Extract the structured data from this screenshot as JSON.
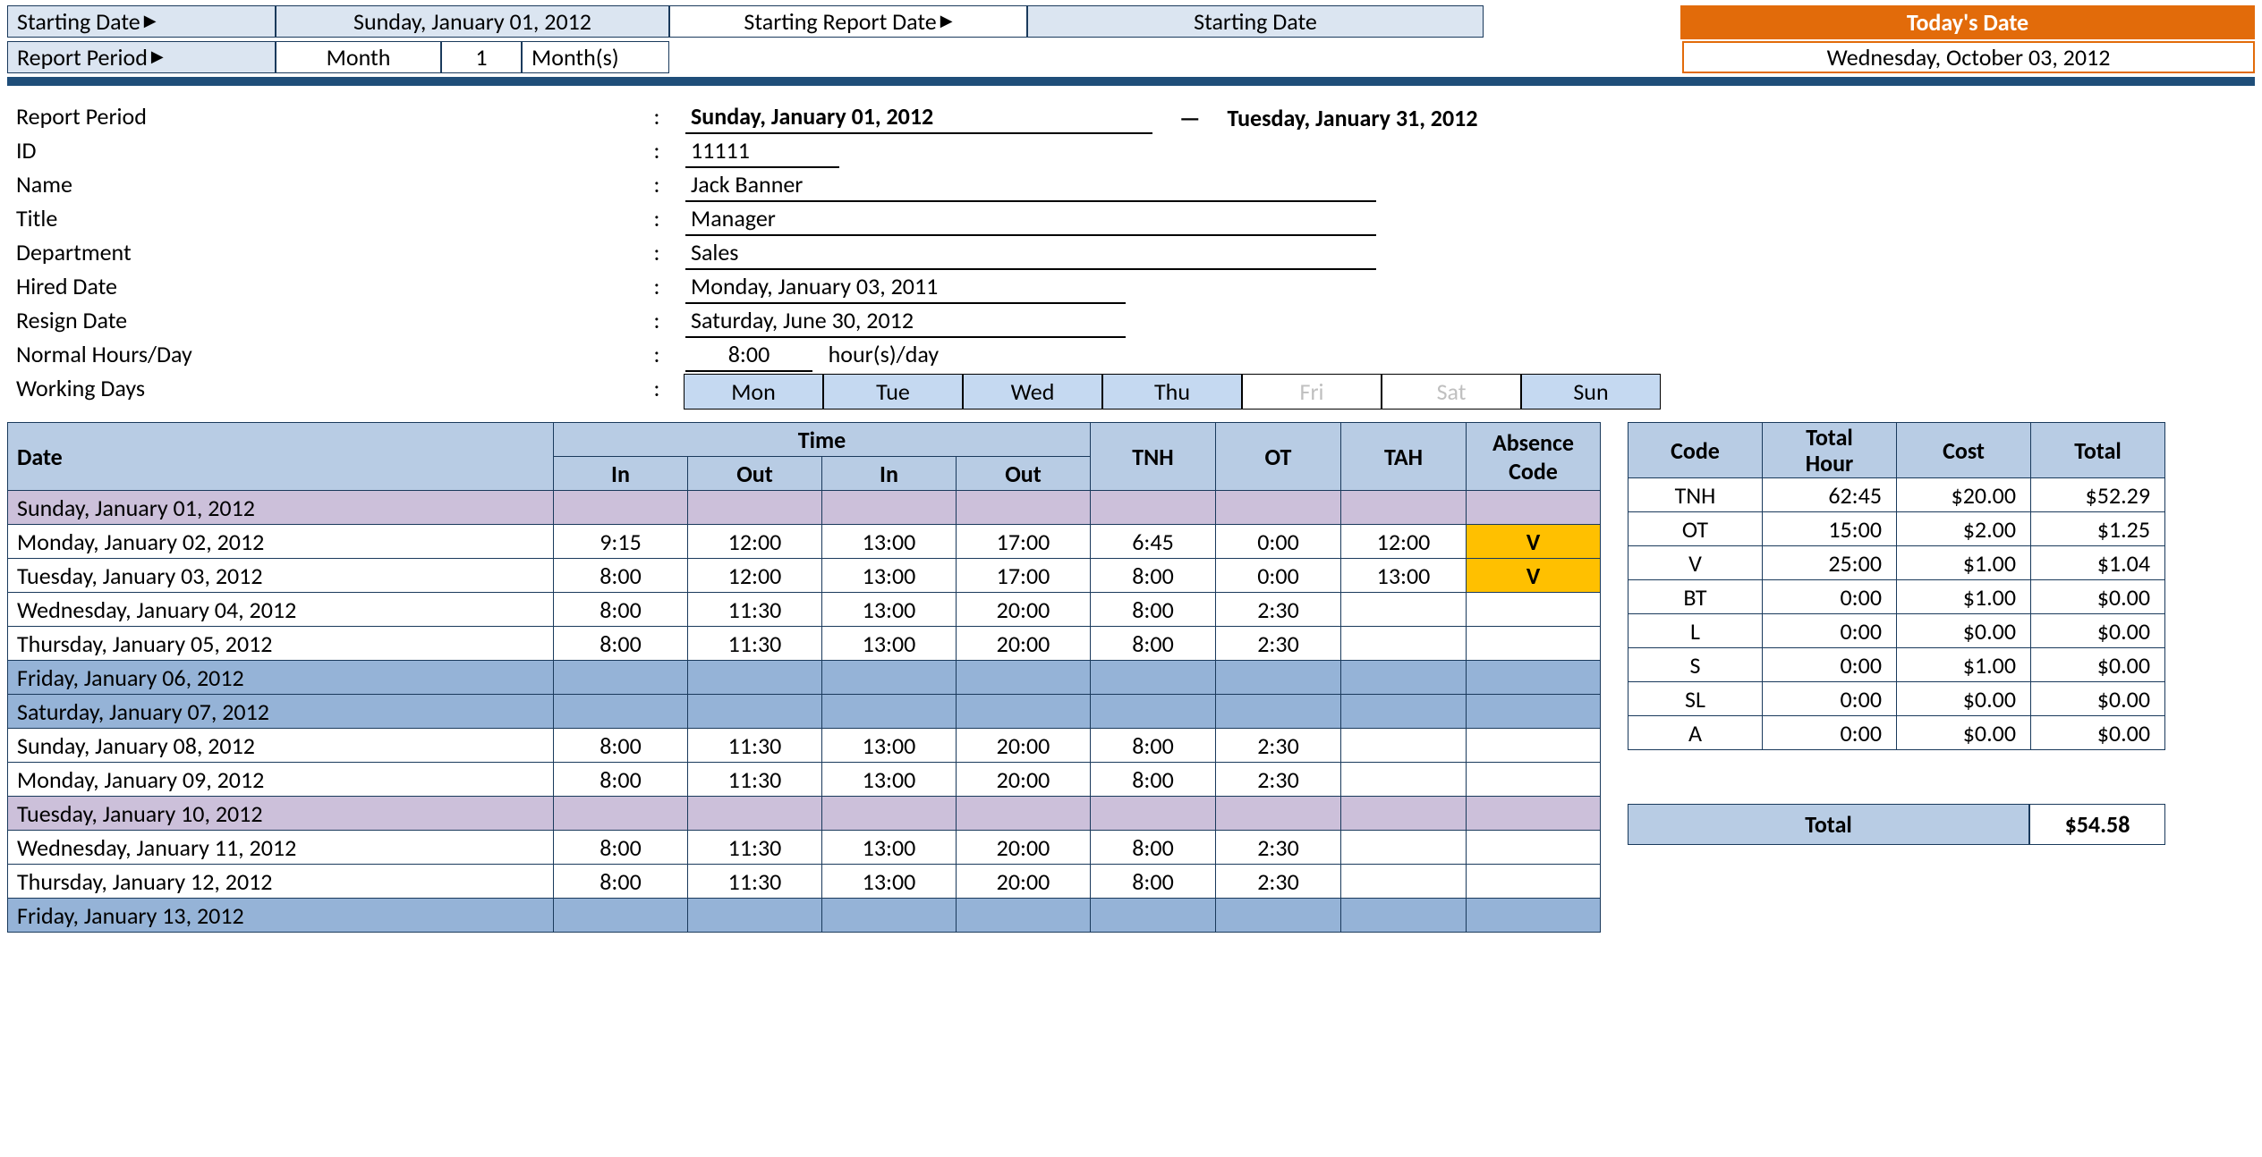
{
  "header": {
    "starting_date_label": "Starting Date",
    "starting_date_value": "Sunday, January 01, 2012",
    "starting_report_label": "Starting Report Date",
    "starting_report_sel": "Starting Date",
    "report_period_label": "Report Period",
    "rp_unit": "Month",
    "rp_qty": "1",
    "rp_suffix": "Month(s)",
    "today_label": "Today's Date",
    "today_value": "Wednesday, October 03, 2012"
  },
  "info": {
    "rp_label": "Report Period",
    "rp_start": "Sunday, January 01, 2012",
    "rp_end": "Tuesday, January 31, 2012",
    "id_label": "ID",
    "id": "11111",
    "name_label": "Name",
    "name": "Jack Banner",
    "title_label": "Title",
    "title": "Manager",
    "dept_label": "Department",
    "dept": "Sales",
    "hired_label": "Hired Date",
    "hired": "Monday, January 03, 2011",
    "resign_label": "Resign Date",
    "resign": "Saturday, June 30, 2012",
    "nhd_label": "Normal Hours/Day",
    "nhd_val": "8:00",
    "nhd_suffix": "hour(s)/day",
    "wd_label": "Working Days"
  },
  "wdays": [
    {
      "d": "Mon",
      "off": false
    },
    {
      "d": "Tue",
      "off": false
    },
    {
      "d": "Wed",
      "off": false
    },
    {
      "d": "Thu",
      "off": false
    },
    {
      "d": "Fri",
      "off": true
    },
    {
      "d": "Sat",
      "off": true
    },
    {
      "d": "Sun",
      "off": false
    }
  ],
  "cols": {
    "date": "Date",
    "time": "Time",
    "in": "In",
    "out": "Out",
    "tnh": "TNH",
    "ot": "OT",
    "tah": "TAH",
    "abs": "Absence Code"
  },
  "rows": [
    {
      "date": "Sunday, January 01, 2012",
      "class": "purple"
    },
    {
      "date": "Monday, January 02, 2012",
      "in1": "9:15",
      "out1": "12:00",
      "in2": "13:00",
      "out2": "17:00",
      "tnh": "6:45",
      "ot": "0:00",
      "tah": "12:00",
      "abs": "V",
      "gold": true
    },
    {
      "date": "Tuesday, January 03, 2012",
      "in1": "8:00",
      "out1": "12:00",
      "in2": "13:00",
      "out2": "17:00",
      "tnh": "8:00",
      "ot": "0:00",
      "tah": "13:00",
      "abs": "V",
      "gold": true
    },
    {
      "date": "Wednesday, January 04, 2012",
      "in1": "8:00",
      "out1": "11:30",
      "in2": "13:00",
      "out2": "20:00",
      "tnh": "8:00",
      "ot": "2:30"
    },
    {
      "date": "Thursday, January 05, 2012",
      "in1": "8:00",
      "out1": "11:30",
      "in2": "13:00",
      "out2": "20:00",
      "tnh": "8:00",
      "ot": "2:30"
    },
    {
      "date": "Friday, January 06, 2012",
      "class": "weekend"
    },
    {
      "date": "Saturday, January 07, 2012",
      "class": "weekend"
    },
    {
      "date": "Sunday, January 08, 2012",
      "in1": "8:00",
      "out1": "11:30",
      "in2": "13:00",
      "out2": "20:00",
      "tnh": "8:00",
      "ot": "2:30"
    },
    {
      "date": "Monday, January 09, 2012",
      "in1": "8:00",
      "out1": "11:30",
      "in2": "13:00",
      "out2": "20:00",
      "tnh": "8:00",
      "ot": "2:30"
    },
    {
      "date": "Tuesday, January 10, 2012",
      "class": "purple"
    },
    {
      "date": "Wednesday, January 11, 2012",
      "in1": "8:00",
      "out1": "11:30",
      "in2": "13:00",
      "out2": "20:00",
      "tnh": "8:00",
      "ot": "2:30"
    },
    {
      "date": "Thursday, January 12, 2012",
      "in1": "8:00",
      "out1": "11:30",
      "in2": "13:00",
      "out2": "20:00",
      "tnh": "8:00",
      "ot": "2:30"
    },
    {
      "date": "Friday, January 13, 2012",
      "class": "weekend"
    }
  ],
  "summary": {
    "cols": {
      "code": "Code",
      "th": "Total Hour",
      "cost": "Cost",
      "tot": "Total"
    },
    "rows": [
      {
        "c": "TNH",
        "h": "62:45",
        "cost": "$20.00",
        "t": "$52.29"
      },
      {
        "c": "OT",
        "h": "15:00",
        "cost": "$2.00",
        "t": "$1.25"
      },
      {
        "c": "V",
        "h": "25:00",
        "cost": "$1.00",
        "t": "$1.04"
      },
      {
        "c": "BT",
        "h": "0:00",
        "cost": "$1.00",
        "t": "$0.00"
      },
      {
        "c": "L",
        "h": "0:00",
        "cost": "$0.00",
        "t": "$0.00"
      },
      {
        "c": "S",
        "h": "0:00",
        "cost": "$1.00",
        "t": "$0.00"
      },
      {
        "c": "SL",
        "h": "0:00",
        "cost": "$0.00",
        "t": "$0.00"
      },
      {
        "c": "A",
        "h": "0:00",
        "cost": "$0.00",
        "t": "$0.00"
      }
    ],
    "total_label": "Total",
    "total_value": "$54.58"
  }
}
